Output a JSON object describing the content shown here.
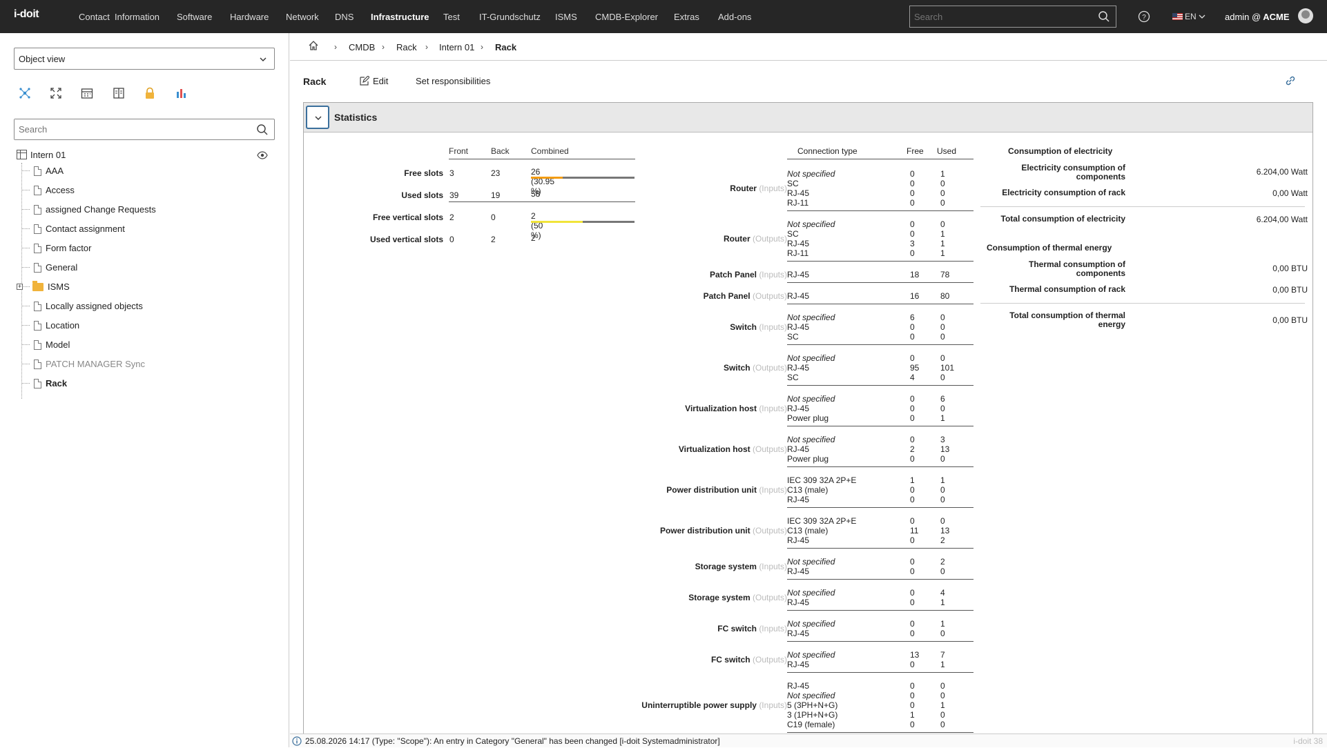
{
  "app": {
    "logo": "i-doit"
  },
  "nav": {
    "items": [
      "Contact",
      "Information",
      "Software",
      "Hardware",
      "Network",
      "DNS",
      "Infrastructure",
      "Test",
      "IT-Grundschutz",
      "ISMS",
      "CMDB-Explorer",
      "Extras",
      "Add-ons"
    ],
    "active": "Infrastructure",
    "search_placeholder": "Search",
    "language": "EN",
    "user": "admin @",
    "tenant": "ACME"
  },
  "sidebar": {
    "view_select": "Object view",
    "search_placeholder": "Search",
    "tools": [
      "network-icon",
      "fullscreen-icon",
      "calendar-icon",
      "book-icon",
      "lock-icon",
      "chart-icon"
    ],
    "tree_root": "Intern 01",
    "tree_items": [
      {
        "label": "AAA"
      },
      {
        "label": "Access"
      },
      {
        "label": "assigned Change Requests"
      },
      {
        "label": "Contact assignment"
      },
      {
        "label": "Form factor"
      },
      {
        "label": "General"
      },
      {
        "label": "ISMS",
        "folder": true
      },
      {
        "label": "Locally assigned objects"
      },
      {
        "label": "Location"
      },
      {
        "label": "Model"
      },
      {
        "label": "PATCH MANAGER Sync",
        "grey": true
      },
      {
        "label": "Rack",
        "bold": true
      }
    ]
  },
  "breadcrumb": [
    "CMDB",
    "Rack",
    "Intern 01",
    "Rack"
  ],
  "actions": {
    "title": "Rack",
    "edit": "Edit",
    "responsibilities": "Set responsibilities"
  },
  "panel": {
    "title": "Statistics"
  },
  "slots": {
    "headers": [
      "Front",
      "Back",
      "Combined"
    ],
    "rows": [
      {
        "label": "Free slots",
        "front": "3",
        "back": "23",
        "combined": "26 (30.95 %)",
        "fill": 0.3095,
        "color": "#f39c12"
      },
      {
        "label": "Used slots",
        "front": "39",
        "back": "19",
        "combined": "58"
      },
      {
        "label": "Free vertical slots",
        "front": "2",
        "back": "0",
        "combined": "2 (50 %)",
        "fill": 0.5,
        "color": "#f1e43a"
      },
      {
        "label": "Used vertical slots",
        "front": "0",
        "back": "2",
        "combined": "2"
      }
    ]
  },
  "connections": {
    "headers": [
      "Connection type",
      "Free",
      "Used"
    ],
    "groups": [
      {
        "name": "Router",
        "io": "(Inputs)",
        "rows": [
          [
            "Not specified",
            "0",
            "1",
            true
          ],
          [
            "SC",
            "0",
            "0"
          ],
          [
            "RJ-45",
            "0",
            "0"
          ],
          [
            "RJ-11",
            "0",
            "0"
          ]
        ]
      },
      {
        "name": "Router",
        "io": "(Outputs)",
        "rows": [
          [
            "Not specified",
            "0",
            "0",
            true
          ],
          [
            "SC",
            "0",
            "1"
          ],
          [
            "RJ-45",
            "3",
            "1"
          ],
          [
            "RJ-11",
            "0",
            "1"
          ]
        ]
      },
      {
        "name": "Patch Panel",
        "io": "(Inputs)",
        "rows": [
          [
            "RJ-45",
            "18",
            "78"
          ]
        ]
      },
      {
        "name": "Patch Panel",
        "io": "(Outputs)",
        "rows": [
          [
            "RJ-45",
            "16",
            "80"
          ]
        ]
      },
      {
        "name": "Switch",
        "io": "(Inputs)",
        "rows": [
          [
            "Not specified",
            "6",
            "0",
            true
          ],
          [
            "RJ-45",
            "0",
            "0"
          ],
          [
            "SC",
            "0",
            "0"
          ]
        ]
      },
      {
        "name": "Switch",
        "io": "(Outputs)",
        "rows": [
          [
            "Not specified",
            "0",
            "0",
            true
          ],
          [
            "RJ-45",
            "95",
            "101"
          ],
          [
            "SC",
            "4",
            "0"
          ]
        ]
      },
      {
        "name": "Virtualization host",
        "io": "(Inputs)",
        "rows": [
          [
            "Not specified",
            "0",
            "6",
            true
          ],
          [
            "RJ-45",
            "0",
            "0"
          ],
          [
            "Power plug",
            "0",
            "1"
          ]
        ]
      },
      {
        "name": "Virtualization host",
        "io": "(Outputs)",
        "rows": [
          [
            "Not specified",
            "0",
            "3",
            true
          ],
          [
            "RJ-45",
            "2",
            "13"
          ],
          [
            "Power plug",
            "0",
            "0"
          ]
        ]
      },
      {
        "name": "Power distribution unit",
        "io": "(Inputs)",
        "rows": [
          [
            "IEC 309 32A 2P+E",
            "1",
            "1"
          ],
          [
            "C13 (male)",
            "0",
            "0"
          ],
          [
            "RJ-45",
            "0",
            "0"
          ]
        ]
      },
      {
        "name": "Power distribution unit",
        "io": "(Outputs)",
        "rows": [
          [
            "IEC 309 32A 2P+E",
            "0",
            "0"
          ],
          [
            "C13 (male)",
            "11",
            "13"
          ],
          [
            "RJ-45",
            "0",
            "2"
          ]
        ]
      },
      {
        "name": "Storage system",
        "io": "(Inputs)",
        "rows": [
          [
            "Not specified",
            "0",
            "2",
            true
          ],
          [
            "RJ-45",
            "0",
            "0"
          ]
        ]
      },
      {
        "name": "Storage system",
        "io": "(Outputs)",
        "rows": [
          [
            "Not specified",
            "0",
            "4",
            true
          ],
          [
            "RJ-45",
            "0",
            "1"
          ]
        ]
      },
      {
        "name": "FC switch",
        "io": "(Inputs)",
        "rows": [
          [
            "Not specified",
            "0",
            "1",
            true
          ],
          [
            "RJ-45",
            "0",
            "0"
          ]
        ]
      },
      {
        "name": "FC switch",
        "io": "(Outputs)",
        "rows": [
          [
            "Not specified",
            "13",
            "7",
            true
          ],
          [
            "RJ-45",
            "0",
            "1"
          ]
        ]
      },
      {
        "name": "Uninterruptible power supply",
        "io": "(Inputs)",
        "rows": [
          [
            "RJ-45",
            "0",
            "0"
          ],
          [
            "Not specified",
            "0",
            "0",
            true
          ],
          [
            "5 (3PH+N+G)",
            "0",
            "1"
          ],
          [
            "3 (1PH+N+G)",
            "1",
            "0"
          ],
          [
            "C19 (female)",
            "0",
            "0"
          ]
        ]
      }
    ]
  },
  "electricity": {
    "section1": "Consumption of electricity",
    "comp_label": "Electricity consumption of components",
    "comp_value": "6.204,00 Watt",
    "rack_label": "Electricity consumption of rack",
    "rack_value": "0,00 Watt",
    "total_label": "Total consumption of electricity",
    "total_value": "6.204,00 Watt",
    "section2": "Consumption of thermal energy",
    "th_comp_label": "Thermal consumption of components",
    "th_comp_value": "0,00 BTU",
    "th_rack_label": "Thermal consumption of rack",
    "th_rack_value": "0,00 BTU",
    "th_total_label": "Total consumption of thermal energy",
    "th_total_value": "0,00 BTU"
  },
  "status": {
    "message": "25.08.2026 14:17 (Type: \"Scope\"): An entry in Category \"General\" has been changed [i-doit Systemadministrator]",
    "version": "i-doit 38"
  },
  "colors": {
    "accent": "#3a6f9c",
    "topbar": "#262626",
    "free_bar": "#f39c12",
    "vertical_bar": "#f1e43a"
  }
}
